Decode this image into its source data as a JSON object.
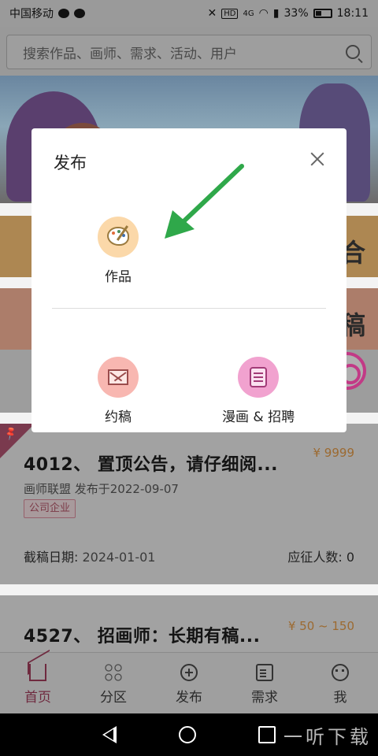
{
  "status_bar": {
    "carrier": "中国移动",
    "battery": "33%",
    "time": "18:11",
    "hd": "HD",
    "signal": "4G"
  },
  "search": {
    "placeholder": "搜索作品、画师、需求、活动、用户"
  },
  "tiles": {
    "tile1_right": "合",
    "tile2_right": "稿"
  },
  "cards": [
    {
      "title": "4012、 置顶公告，请仔细阅...",
      "price": "¥ 9999",
      "meta": "画师联盟 发布于2022-09-07",
      "tag": "公司企业",
      "deadline_label": "截稿日期:",
      "deadline_value": "2024-01-01",
      "applicants_label": "应征人数:",
      "applicants_value": "0"
    },
    {
      "title": "4527、 招画师：长期有稿...",
      "price": "¥ 50 ~ 150"
    }
  ],
  "tabbar": [
    {
      "label": "首页",
      "icon": "home-icon",
      "active": true
    },
    {
      "label": "分区",
      "icon": "grid-icon",
      "active": false
    },
    {
      "label": "发布",
      "icon": "plus-circle-icon",
      "active": false
    },
    {
      "label": "需求",
      "icon": "clipboard-icon",
      "active": false
    },
    {
      "label": "我",
      "icon": "profile-icon",
      "active": false
    }
  ],
  "modal": {
    "title": "发布",
    "options": [
      {
        "label": "作品",
        "icon": "palette-icon",
        "color": "#fbd8a9"
      },
      {
        "label": "约稿",
        "icon": "envelope-icon",
        "color": "#f8b7b1"
      },
      {
        "label": "漫画 & 招聘",
        "icon": "document-icon",
        "color": "#f1a2cf"
      }
    ]
  },
  "watermark": "一听下载",
  "colors": {
    "accent": "#6f2a3f",
    "arrow": "#2fa84a",
    "float_ring": "#c23a86"
  }
}
